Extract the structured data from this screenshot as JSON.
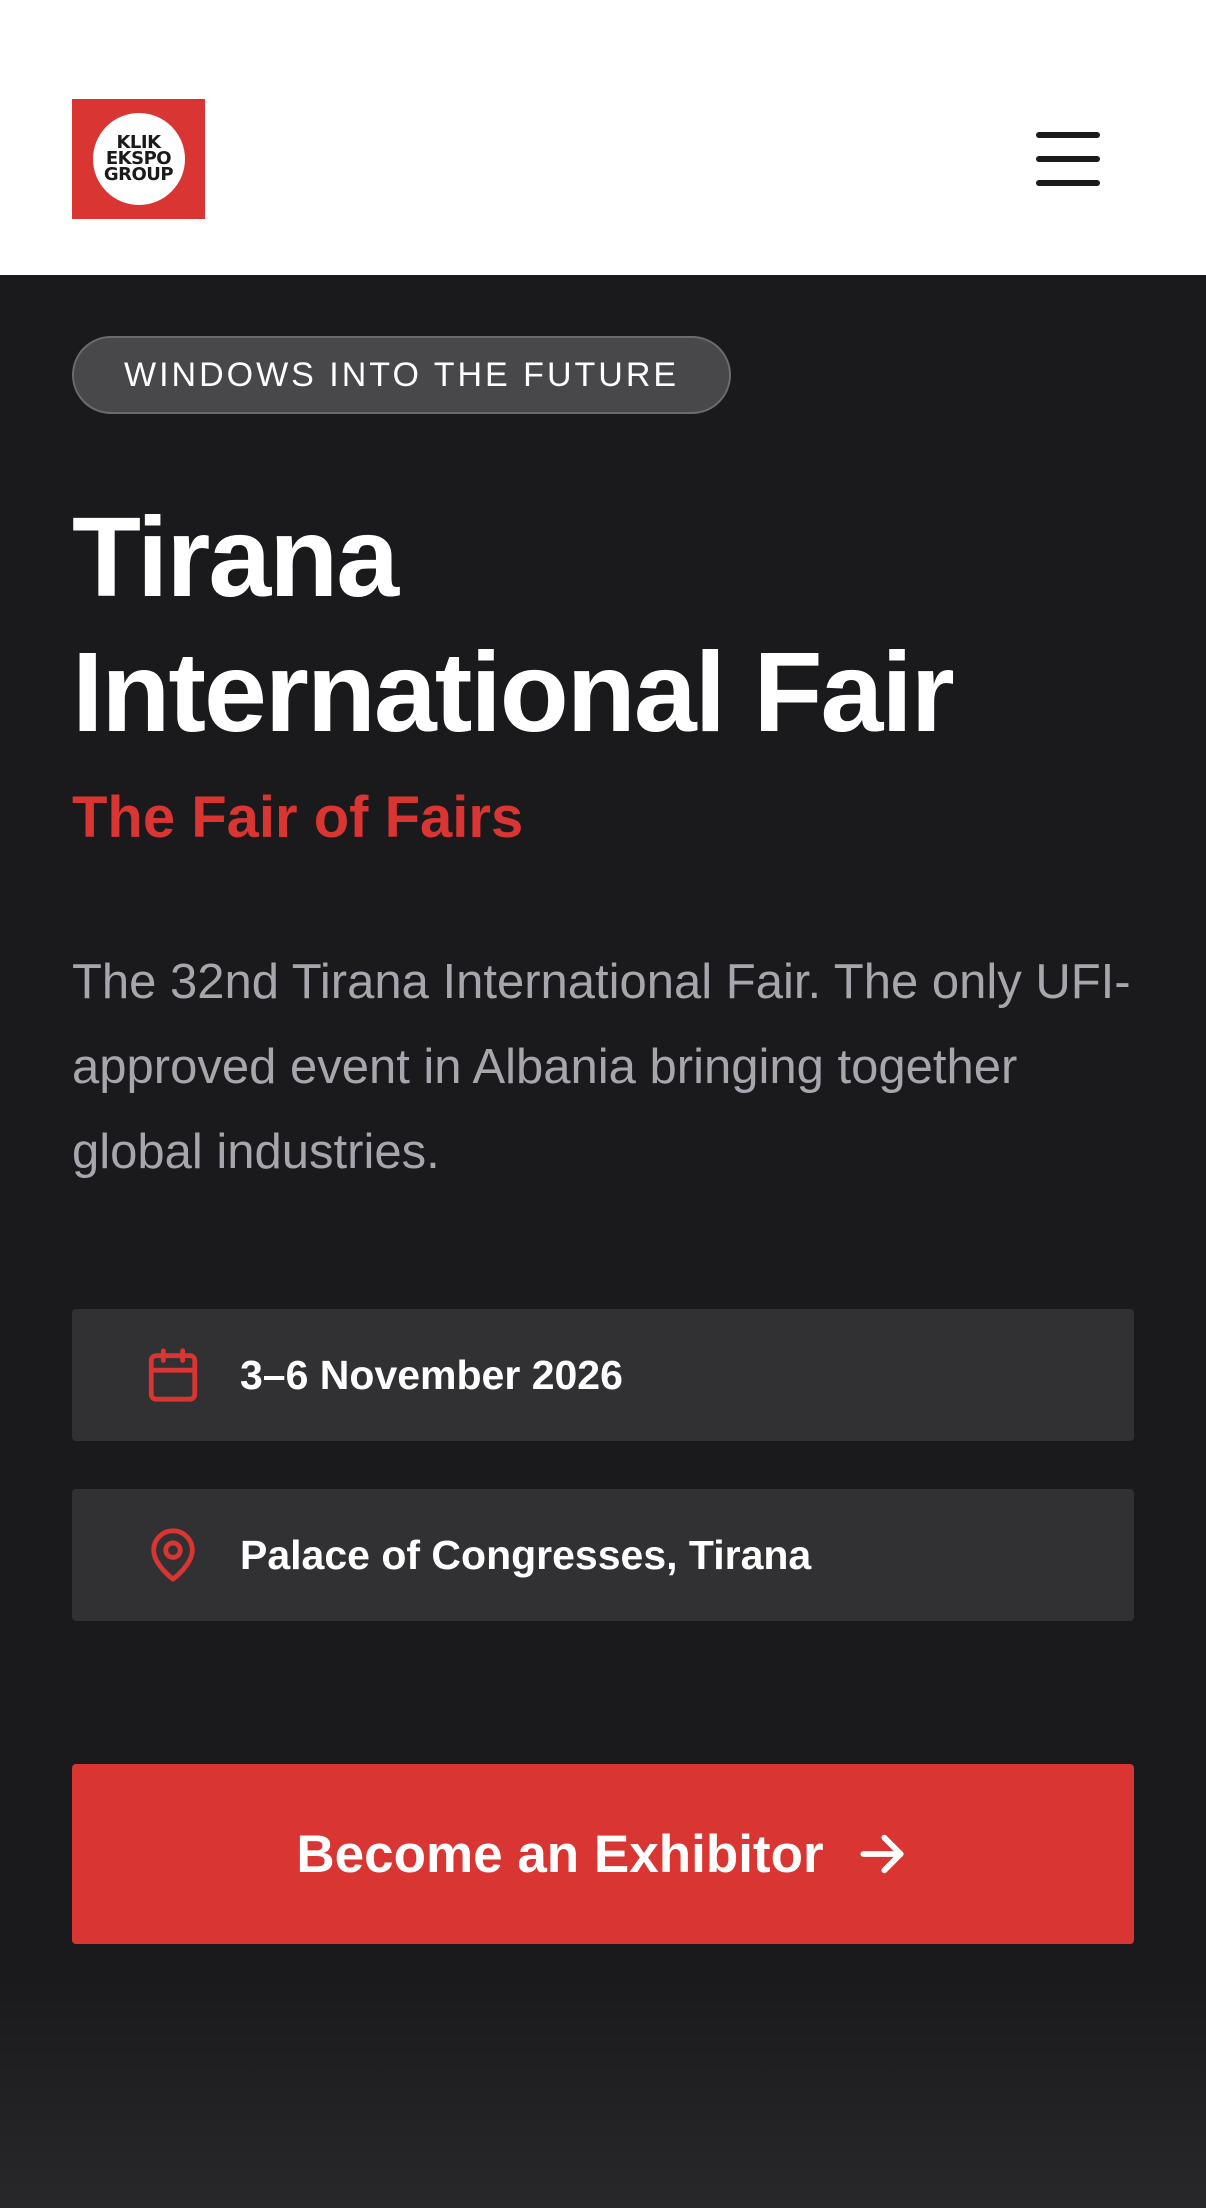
{
  "header": {
    "logo": {
      "lines": [
        "KLIK",
        "EKSPO",
        "GROUP"
      ]
    },
    "menu_icon": "hamburger-menu-icon"
  },
  "hero": {
    "tag": "WINDOWS INTO THE FUTURE",
    "title_line1": "Tirana",
    "title_line2": "International Fair",
    "subtitle": "The Fair of Fairs",
    "description": "The 32nd Tirana International Fair. The only UFI-approved event in Albania bringing together global industries.",
    "date": {
      "icon": "calendar-icon",
      "text": "3–6 November 2026"
    },
    "location": {
      "icon": "map-pin-icon",
      "text": "Palace of Congresses, Tirana"
    },
    "cta": {
      "label": "Become an Exhibitor",
      "icon": "arrow-right-icon"
    }
  },
  "colors": {
    "accent": "#d93532",
    "background": "#1a191b",
    "card": "#313033",
    "muted_text": "#a7a6ad"
  }
}
